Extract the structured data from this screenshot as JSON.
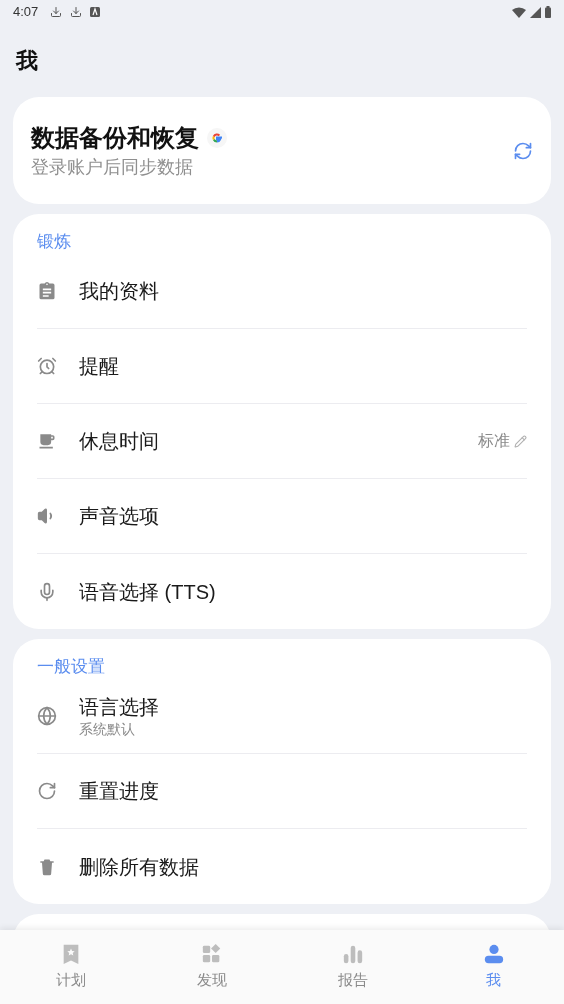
{
  "status_bar": {
    "time": "4:07"
  },
  "title": "我",
  "backup_card": {
    "title": "数据备份和恢复",
    "subtitle": "登录账户后同步数据"
  },
  "sections": [
    {
      "heading": "锻炼",
      "items": [
        {
          "label": "我的资料"
        },
        {
          "label": "提醒"
        },
        {
          "label": "休息时间",
          "value": "标准"
        },
        {
          "label": "声音选项"
        },
        {
          "label": "语音选择 (TTS)"
        }
      ]
    },
    {
      "heading": "一般设置",
      "items": [
        {
          "label": "语言选择",
          "subtitle": "系统默认"
        },
        {
          "label": "重置进度"
        },
        {
          "label": "删除所有数据"
        }
      ]
    }
  ],
  "bottom_nav": [
    {
      "label": "计划",
      "selected": false
    },
    {
      "label": "发现",
      "selected": false
    },
    {
      "label": "报告",
      "selected": false
    },
    {
      "label": "我",
      "selected": true
    }
  ]
}
